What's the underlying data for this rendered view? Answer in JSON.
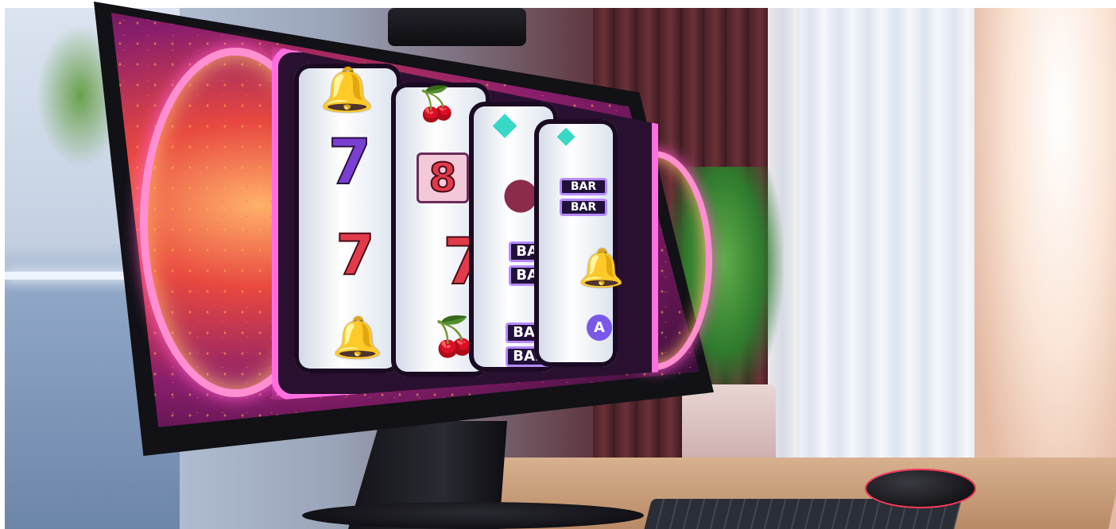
{
  "scene": {
    "description_visible_text": [],
    "reels": [
      {
        "symbols": [
          {
            "type": "bell-icon"
          },
          {
            "type": "seven",
            "label": "7",
            "color": "purple"
          },
          {
            "type": "seven",
            "label": "7",
            "color": "red"
          },
          {
            "type": "bell-icon"
          }
        ]
      },
      {
        "symbols": [
          {
            "type": "cherry-icon"
          },
          {
            "type": "seven",
            "label": "8",
            "color": "red-box"
          },
          {
            "type": "seven",
            "label": "7",
            "color": "red"
          },
          {
            "type": "cherry-icon"
          }
        ]
      },
      {
        "symbols": [
          {
            "type": "gem-icon"
          },
          {
            "type": "plum-icon"
          },
          {
            "type": "bar",
            "labels": [
              "BAR",
              "BAR"
            ]
          },
          {
            "type": "bar",
            "labels": [
              "BAR",
              "BAR"
            ]
          }
        ]
      },
      {
        "symbols": [
          {
            "type": "gem-icon"
          },
          {
            "type": "bar",
            "labels": [
              "BAR",
              "BAR"
            ]
          },
          {
            "type": "bell-icon"
          },
          {
            "type": "letter",
            "label": "A"
          }
        ]
      }
    ]
  },
  "colors": {
    "neon_pink": "#ff6fe0",
    "screen_orange": "#ffb16a",
    "screen_purple": "#8a1e6c",
    "mouse_accent": "#ff3b5c"
  }
}
